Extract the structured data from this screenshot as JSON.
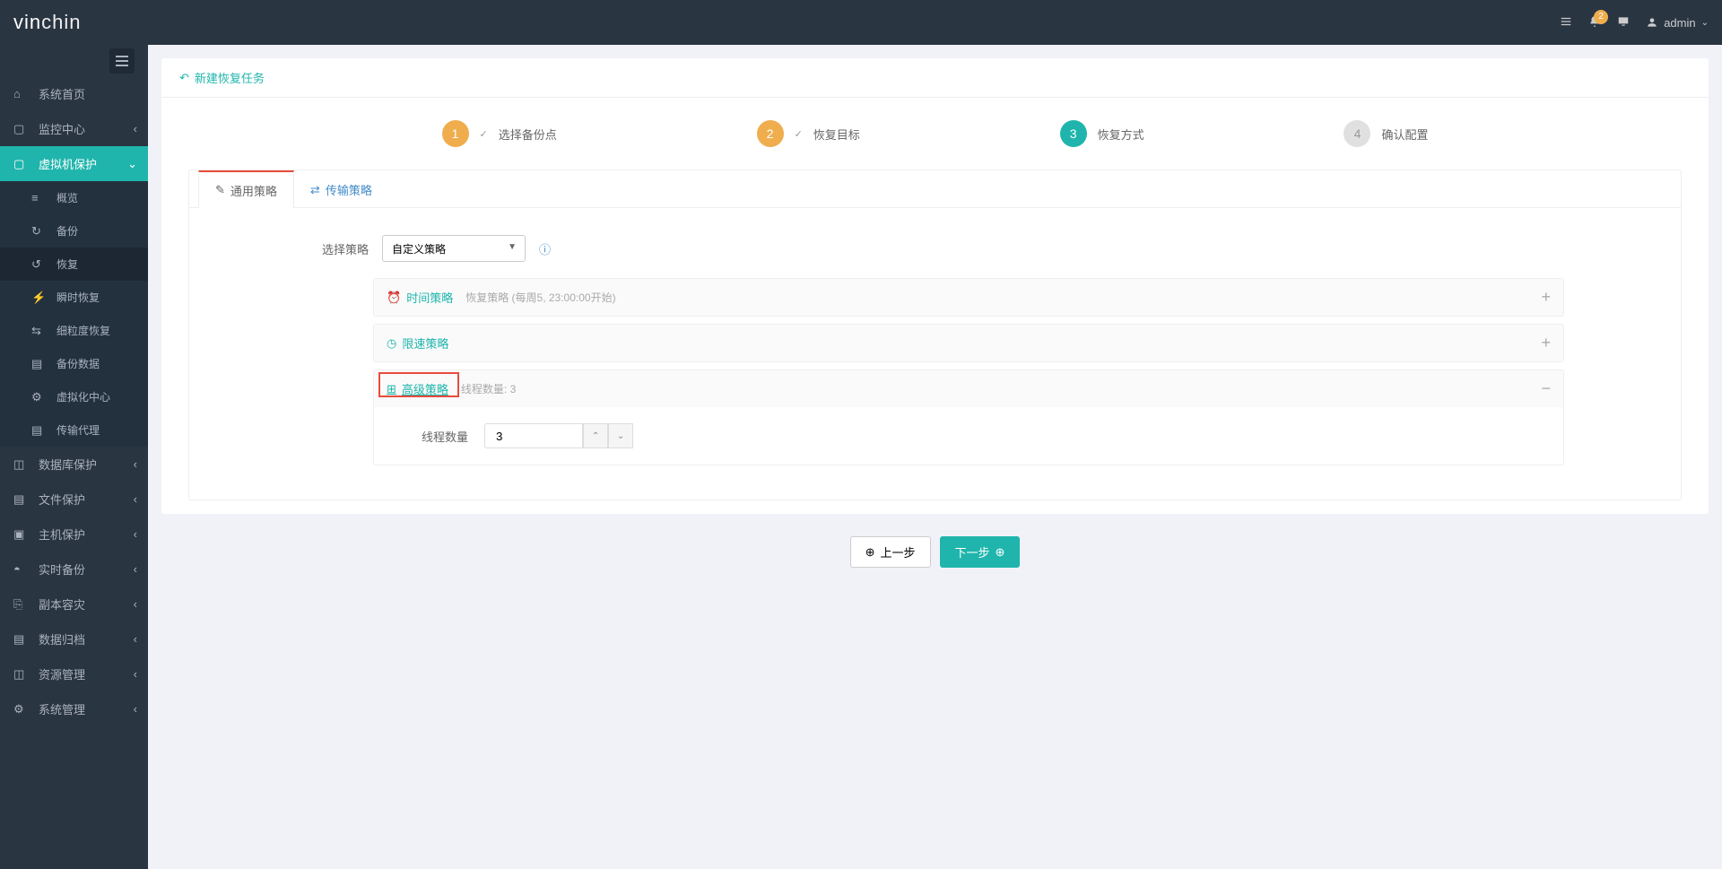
{
  "brand": "vinchin",
  "header": {
    "notification_count": "2",
    "username": "admin"
  },
  "sidebar": {
    "items": [
      {
        "label": "系统首页"
      },
      {
        "label": "监控中心"
      },
      {
        "label": "虚拟机保护"
      },
      {
        "label": "数据库保护"
      },
      {
        "label": "文件保护"
      },
      {
        "label": "主机保护"
      },
      {
        "label": "实时备份"
      },
      {
        "label": "副本容灾"
      },
      {
        "label": "数据归档"
      },
      {
        "label": "资源管理"
      },
      {
        "label": "系统管理"
      }
    ],
    "submenu": [
      {
        "label": "概览"
      },
      {
        "label": "备份"
      },
      {
        "label": "恢复"
      },
      {
        "label": "瞬时恢复"
      },
      {
        "label": "细粒度恢复"
      },
      {
        "label": "备份数据"
      },
      {
        "label": "虚拟化中心"
      },
      {
        "label": "传输代理"
      }
    ]
  },
  "page": {
    "title": "新建恢复任务",
    "steps": [
      {
        "num": "1",
        "label": "选择备份点"
      },
      {
        "num": "2",
        "label": "恢复目标"
      },
      {
        "num": "3",
        "label": "恢复方式"
      },
      {
        "num": "4",
        "label": "确认配置"
      }
    ],
    "tabs": {
      "general": "通用策略",
      "transfer": "传输策略"
    },
    "strategy": {
      "label": "选择策略",
      "value": "自定义策略"
    },
    "panels": {
      "time": {
        "title": "时间策略",
        "desc": "恢复策略 (每周5, 23:00:00开始)"
      },
      "speed": {
        "title": "限速策略"
      },
      "advanced": {
        "title": "高级策略",
        "desc": "线程数量: 3"
      }
    },
    "thread": {
      "label": "线程数量",
      "value": "3"
    },
    "buttons": {
      "prev": "上一步",
      "next": "下一步"
    }
  }
}
